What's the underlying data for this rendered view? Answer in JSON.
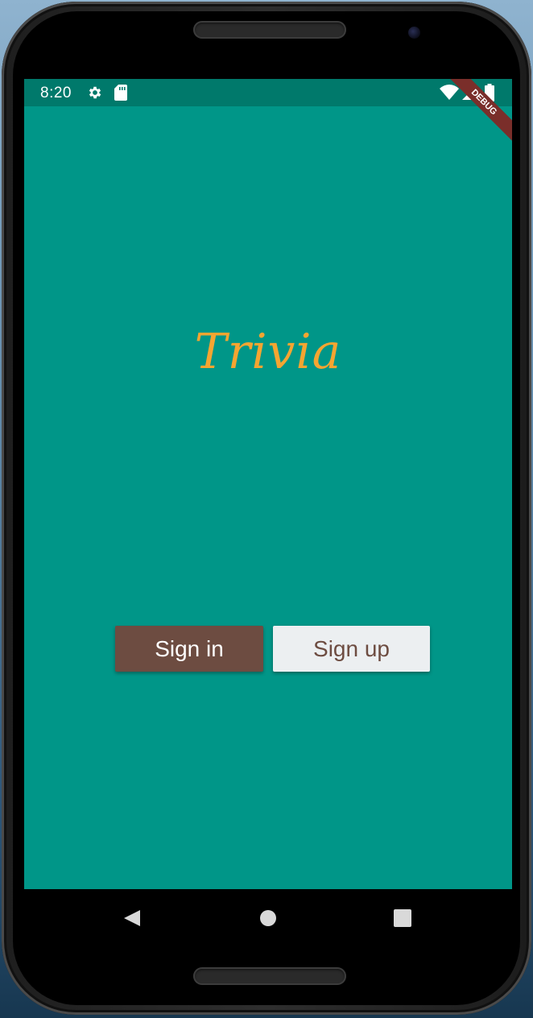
{
  "status_bar": {
    "time": "8:20",
    "icons": [
      "settings-icon",
      "sd-card-icon",
      "wifi-icon",
      "signal-icon",
      "battery-icon"
    ],
    "debug_label": "DEBUG"
  },
  "app": {
    "title": "Trivia",
    "sign_in_label": "Sign in",
    "sign_up_label": "Sign up"
  },
  "nav_bar": {
    "icons": [
      "back-icon",
      "home-icon",
      "recents-icon"
    ]
  },
  "colors": {
    "background": "#009688",
    "status_bar": "#00796b",
    "title": "#f5a531",
    "sign_in_button": "#6d4c41",
    "sign_up_button": "#eceff1"
  }
}
